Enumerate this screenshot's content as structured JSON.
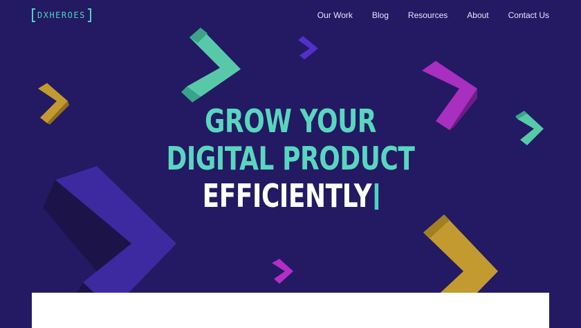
{
  "logo": {
    "text": "DXHEROES"
  },
  "nav": {
    "items": [
      {
        "label": "Our Work"
      },
      {
        "label": "Blog"
      },
      {
        "label": "Resources"
      },
      {
        "label": "About"
      },
      {
        "label": "Contact Us"
      }
    ]
  },
  "hero": {
    "line1": "GROW YOUR",
    "line2": "DIGITAL PRODUCT",
    "line3": "EFFICIENTLY"
  },
  "colors": {
    "background": "#231a63",
    "teal": "#5ad6c0",
    "purple": "#3a2a9e",
    "magenta": "#a82fc0",
    "gold": "#c39a2f"
  }
}
